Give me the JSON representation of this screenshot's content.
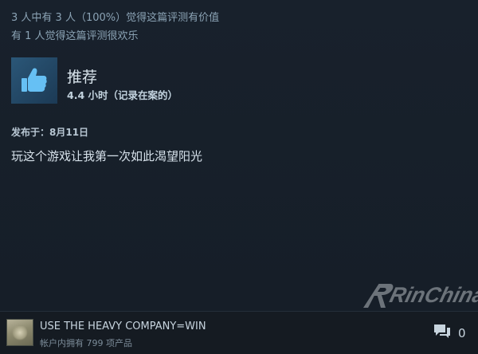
{
  "helpful": {
    "line1": "3 人中有 3 人（100%）觉得这篇评测有价值",
    "line2": "有 1 人觉得这篇评测很欢乐"
  },
  "review": {
    "recommend_label": "推荐",
    "playtime": "4.4 小时（记录在案的）",
    "posted": "发布于：8月11日",
    "text": "玩这个游戏让我第一次如此渴望阳光"
  },
  "author": {
    "name": "USE THE HEAVY COMPANY=WIN",
    "products": "帐户内拥有 799 项产品"
  },
  "comments": {
    "count": "0"
  },
  "watermark": {
    "text": "RinChina"
  },
  "icons": {
    "thumb": "thumbs-up-icon",
    "comment": "comment-icon"
  },
  "colors": {
    "background": "#171d25",
    "thumb_bg": "#2b5778",
    "thumb_fg": "#66c0f4",
    "text_muted": "#8ba3b5"
  }
}
